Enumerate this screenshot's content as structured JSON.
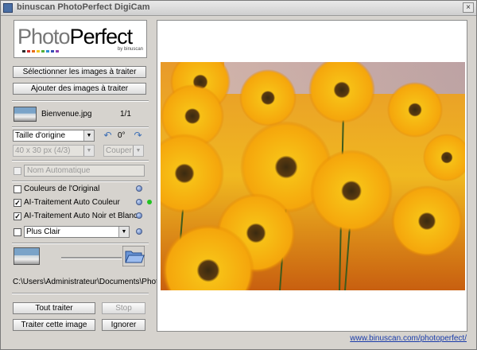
{
  "window": {
    "title": "binuscan PhotoPerfect DigiCam",
    "close_symbol": "×"
  },
  "logo": {
    "part1": "Photo",
    "part2": "Perfect",
    "byline": "by binuscan",
    "dot_colors": [
      "#2a2a2a",
      "#d12b2b",
      "#e86d1b",
      "#f2c61f",
      "#55b03a",
      "#2c8fd6",
      "#3a4fb5",
      "#8c3fb0"
    ]
  },
  "buttons": {
    "select_images": "Sélectionner les images à traiter",
    "add_images": "Ajouter des images à traiter",
    "process_all": "Tout traiter",
    "stop": "Stop",
    "process_this": "Traiter cette image",
    "ignore": "Ignorer"
  },
  "file": {
    "name": "Bienvenue.jpg",
    "counter": "1/1"
  },
  "size": {
    "selected": "Taille d'origine",
    "rotation": "0°",
    "dimension": "40 x 30 px (4/3)",
    "crop": "Couper"
  },
  "auto_name": {
    "checked": false,
    "placeholder": "Nom Automatique"
  },
  "options": [
    {
      "label": "Couleurs de l'Original",
      "checked": false,
      "status": ""
    },
    {
      "label": "AI-Traitement Auto Couleur",
      "checked": true,
      "status": "green"
    },
    {
      "label": "AI-Traitement Auto Noir et Blanc",
      "checked": true,
      "status": ""
    }
  ],
  "brightness": {
    "checked": false,
    "selected": "Plus Clair"
  },
  "output_path": "C:\\Users\\Administrateur\\Documents\\PhotoPerfe",
  "slider": {
    "value": 1.0
  },
  "footer": {
    "link": "www.binuscan.com/photoperfect/"
  },
  "colors": {
    "accent": "#3c6eb4",
    "link": "#1a3caa",
    "status_green": "#21c221"
  }
}
